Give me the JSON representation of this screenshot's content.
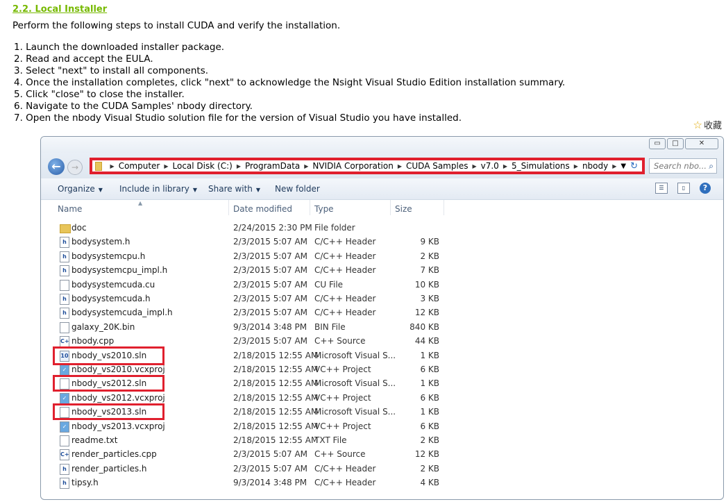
{
  "doc": {
    "heading": "2.2. Local Installer",
    "intro": "Perform the following steps to install CUDA and verify the installation.",
    "steps": [
      "1. Launch the downloaded installer package.",
      "2. Read and accept the EULA.",
      "3. Select \"next\" to install all components.",
      "4. Once the installation completes, click \"next\" to acknowledge the Nsight Visual Studio Edition installation summary.",
      "5. Click \"close\" to close the installer.",
      "6. Navigate to the CUDA Samples' nbody directory.",
      "7. Open the nbody Visual Studio solution file for the version of Visual Studio you have installed."
    ],
    "favorite_label": "收藏"
  },
  "explorer": {
    "window_controls": {
      "minimize": "▭",
      "maximize": "□",
      "close": "✕"
    },
    "breadcrumbs": [
      "Computer",
      "Local Disk (C:)",
      "ProgramData",
      "NVIDIA Corporation",
      "CUDA Samples",
      "v7.0",
      "5_Simulations",
      "nbody"
    ],
    "search_placeholder": "Search nbo...",
    "toolbar": {
      "organize": "Organize",
      "include": "Include in library",
      "share": "Share with",
      "new_folder": "New folder"
    },
    "columns": {
      "name": "Name",
      "date": "Date modified",
      "type": "Type",
      "size": "Size"
    },
    "files": [
      {
        "name": "doc",
        "date": "2/24/2015 2:30 PM",
        "type": "File folder",
        "size": "",
        "icon": "folder-icon"
      },
      {
        "name": "bodysystem.h",
        "date": "2/3/2015 5:07 AM",
        "type": "C/C++ Header",
        "size": "9 KB",
        "icon": "header-file-icon"
      },
      {
        "name": "bodysystemcpu.h",
        "date": "2/3/2015 5:07 AM",
        "type": "C/C++ Header",
        "size": "2 KB",
        "icon": "header-file-icon"
      },
      {
        "name": "bodysystemcpu_impl.h",
        "date": "2/3/2015 5:07 AM",
        "type": "C/C++ Header",
        "size": "7 KB",
        "icon": "header-file-icon"
      },
      {
        "name": "bodysystemcuda.cu",
        "date": "2/3/2015 5:07 AM",
        "type": "CU File",
        "size": "10 KB",
        "icon": "blank-file-icon"
      },
      {
        "name": "bodysystemcuda.h",
        "date": "2/3/2015 5:07 AM",
        "type": "C/C++ Header",
        "size": "3 KB",
        "icon": "header-file-icon"
      },
      {
        "name": "bodysystemcuda_impl.h",
        "date": "2/3/2015 5:07 AM",
        "type": "C/C++ Header",
        "size": "12 KB",
        "icon": "header-file-icon"
      },
      {
        "name": "galaxy_20K.bin",
        "date": "9/3/2014 3:48 PM",
        "type": "BIN File",
        "size": "840 KB",
        "icon": "blank-file-icon"
      },
      {
        "name": "nbody.cpp",
        "date": "2/3/2015 5:07 AM",
        "type": "C++ Source",
        "size": "44 KB",
        "icon": "cpp-file-icon"
      },
      {
        "name": "nbody_vs2010.sln",
        "date": "2/18/2015 12:55 AM",
        "type": "Microsoft Visual S...",
        "size": "1 KB",
        "icon": "sln-file-icon"
      },
      {
        "name": "nbody_vs2010.vcxproj",
        "date": "2/18/2015 12:55 AM",
        "type": "VC++ Project",
        "size": "6 KB",
        "icon": "vcxproj-file-icon"
      },
      {
        "name": "nbody_vs2012.sln",
        "date": "2/18/2015 12:55 AM",
        "type": "Microsoft Visual S...",
        "size": "1 KB",
        "icon": "blank-file-icon"
      },
      {
        "name": "nbody_vs2012.vcxproj",
        "date": "2/18/2015 12:55 AM",
        "type": "VC++ Project",
        "size": "6 KB",
        "icon": "vcxproj-file-icon"
      },
      {
        "name": "nbody_vs2013.sln",
        "date": "2/18/2015 12:55 AM",
        "type": "Microsoft Visual S...",
        "size": "1 KB",
        "icon": "blank-file-icon"
      },
      {
        "name": "nbody_vs2013.vcxproj",
        "date": "2/18/2015 12:55 AM",
        "type": "VC++ Project",
        "size": "6 KB",
        "icon": "vcxproj-file-icon"
      },
      {
        "name": "readme.txt",
        "date": "2/18/2015 12:55 AM",
        "type": "TXT File",
        "size": "2 KB",
        "icon": "blank-file-icon"
      },
      {
        "name": "render_particles.cpp",
        "date": "2/3/2015 5:07 AM",
        "type": "C++ Source",
        "size": "12 KB",
        "icon": "cpp-file-icon"
      },
      {
        "name": "render_particles.h",
        "date": "2/3/2015 5:07 AM",
        "type": "C/C++ Header",
        "size": "2 KB",
        "icon": "header-file-icon"
      },
      {
        "name": "tipsy.h",
        "date": "9/3/2014 3:48 PM",
        "type": "C/C++ Header",
        "size": "4 KB",
        "icon": "header-file-icon"
      }
    ],
    "highlight_color": "#e0202e"
  }
}
